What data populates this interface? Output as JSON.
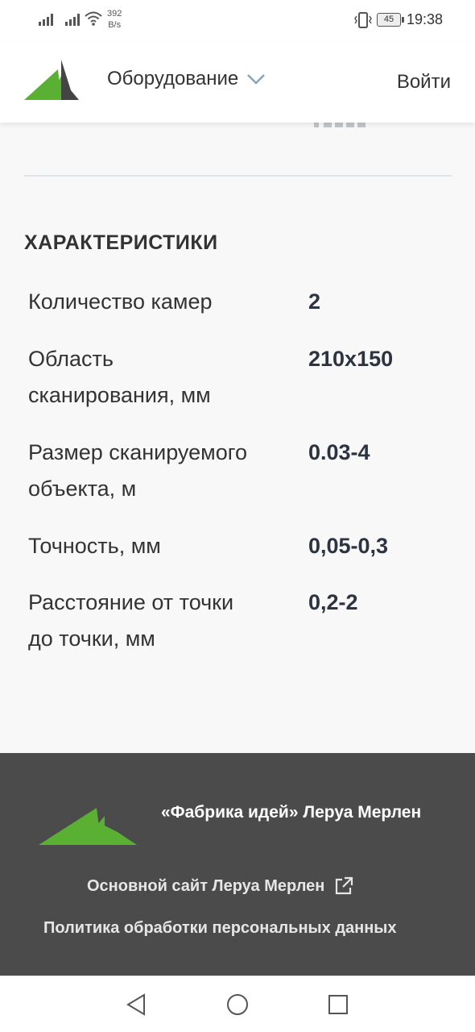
{
  "status_bar": {
    "network_speed_value": "392",
    "network_speed_unit": "B/s",
    "battery": "45",
    "time": "19:38"
  },
  "header": {
    "nav_label": "Оборудование",
    "login_label": "Войти"
  },
  "specs": {
    "title": "ХАРАКТЕРИСТИКИ",
    "rows": [
      {
        "name_line1": "Количество камер",
        "name_line2": "",
        "value": "2"
      },
      {
        "name_line1": "Область",
        "name_line2": "сканирования, мм",
        "value": "210x150"
      },
      {
        "name_line1": "Размер сканируемого",
        "name_line2": "объекта, м",
        "value": "0.03-4"
      },
      {
        "name_line1": "Точность, мм",
        "name_line2": "",
        "value": "0,05-0,3"
      },
      {
        "name_line1": "Расстояние от точки",
        "name_line2": "до точки, мм",
        "value": "0,2-2"
      }
    ]
  },
  "footer": {
    "title": "«Фабрика идей» Леруа Мерлен",
    "main_site_link": "Основной сайт Леруа Мерлен",
    "privacy_link": "Политика обработки персональных данных"
  },
  "colors": {
    "brand_green": "#5ab033",
    "footer_bg": "#4b4b4b",
    "value_text": "#2b3440"
  },
  "icons": {
    "dropdown": "chevron-down-icon",
    "external": "external-link-icon",
    "back": "back-triangle-icon",
    "home": "home-circle-icon",
    "recents": "recents-square-icon"
  }
}
